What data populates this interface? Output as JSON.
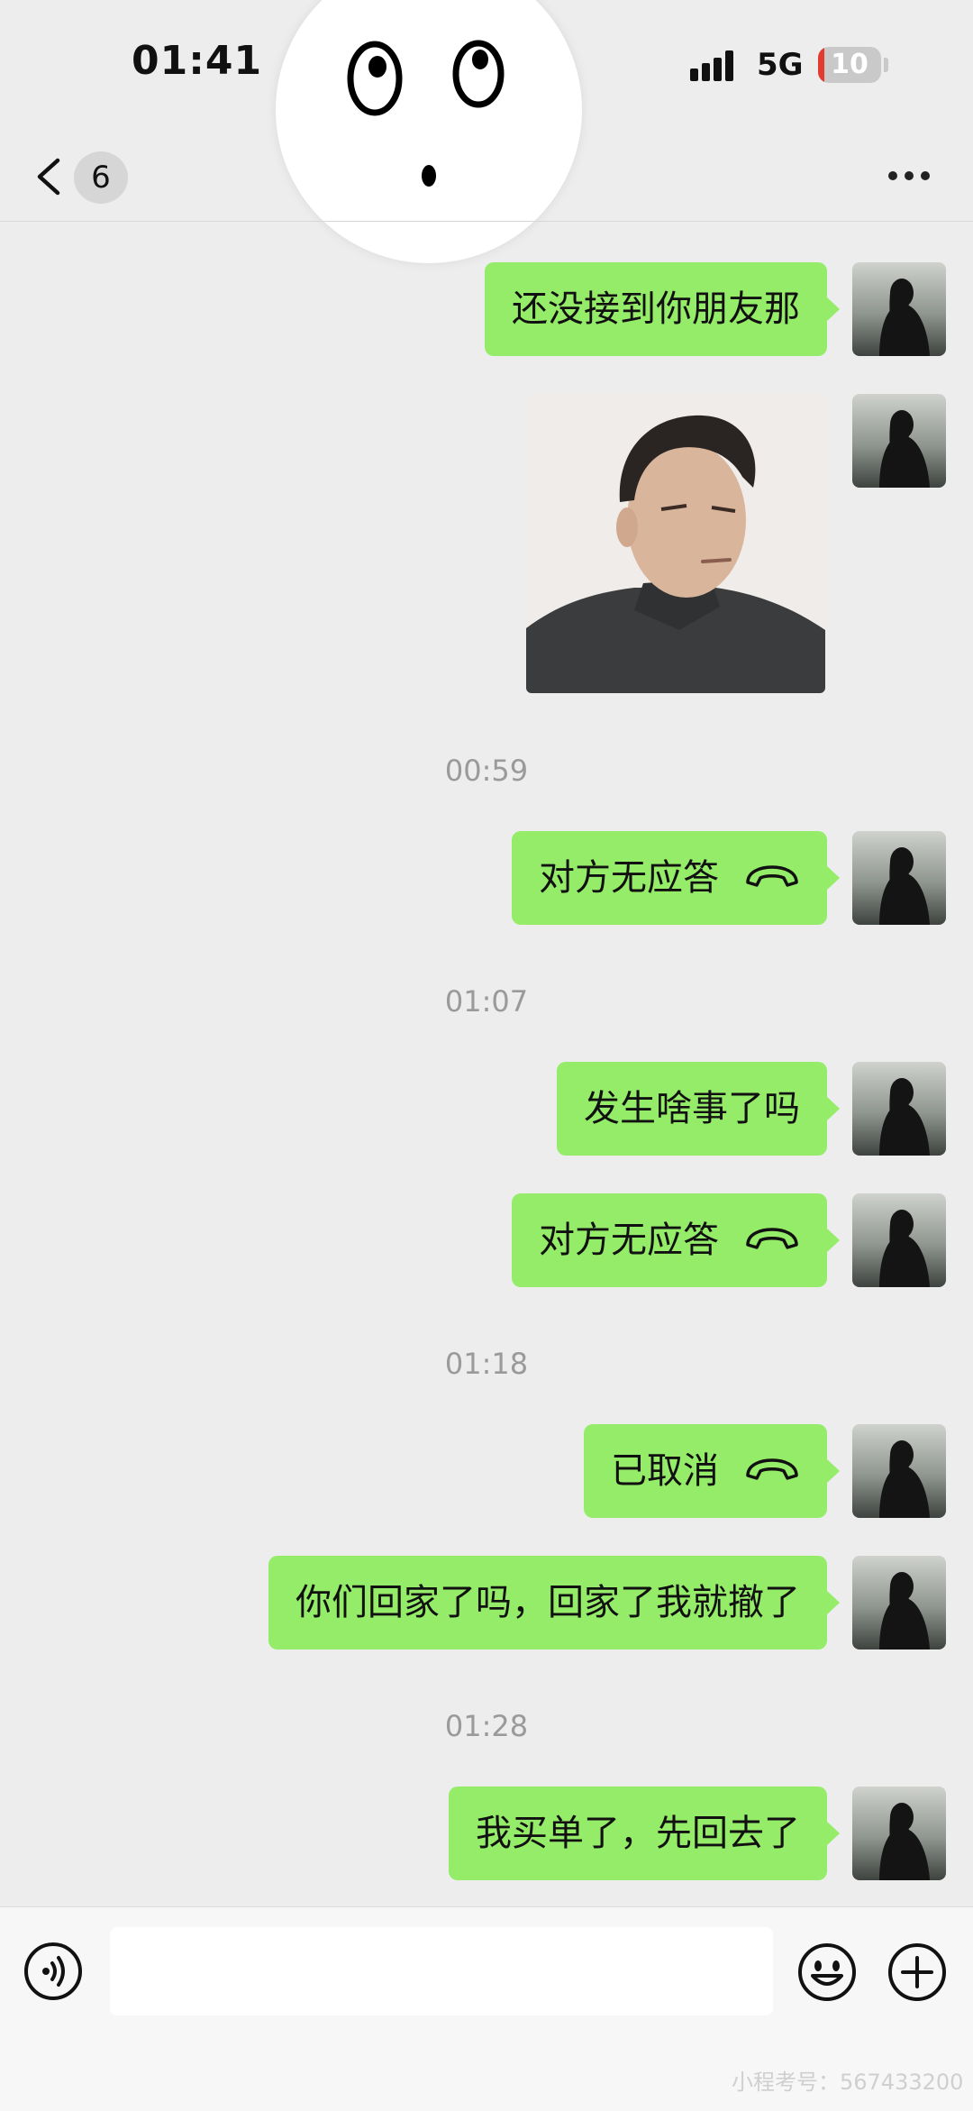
{
  "status_bar": {
    "time": "01:41",
    "network": "5G",
    "battery": "10",
    "battery_level": 0.1
  },
  "nav": {
    "back_count": "6",
    "more_icon": "more-dots-icon",
    "back_icon": "chevron-left-icon"
  },
  "messages": [
    {
      "type": "text",
      "text": "还没接到你朋友那"
    },
    {
      "type": "image",
      "alt_icon": "photo-man-icon"
    },
    {
      "type": "time",
      "text": "00:59"
    },
    {
      "type": "call",
      "text": "对方无应答",
      "icon": "phone-hangup-icon"
    },
    {
      "type": "time",
      "text": "01:07"
    },
    {
      "type": "text",
      "text": "发生啥事了吗"
    },
    {
      "type": "call",
      "text": "对方无应答",
      "icon": "phone-hangup-icon"
    },
    {
      "type": "time",
      "text": "01:18"
    },
    {
      "type": "call",
      "text": "已取消",
      "icon": "phone-hangup-icon"
    },
    {
      "type": "text",
      "text": "你们回家了吗，回家了我就撤了"
    },
    {
      "type": "time",
      "text": "01:28"
    },
    {
      "type": "text",
      "text": "我买单了，先回去了"
    }
  ],
  "input_bar": {
    "value": "",
    "icons": [
      "voice-icon",
      "emoji-icon",
      "plus-icon"
    ]
  },
  "watermark": "小程考号：567433200",
  "colors": {
    "bubble": "#95ec69",
    "background": "#ededed",
    "battery_low": "#e43b30"
  }
}
